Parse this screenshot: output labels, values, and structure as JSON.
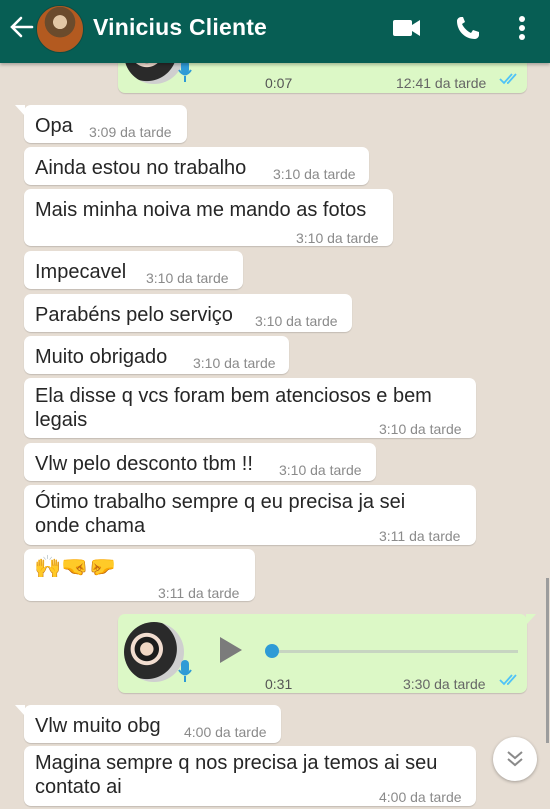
{
  "header": {
    "contact_name": "Vinicius Cliente",
    "icons": [
      "back-arrow-icon",
      "contact-avatar",
      "video-call-icon",
      "phone-call-icon",
      "more-options-icon"
    ],
    "color": "#075e54"
  },
  "voice_messages": [
    {
      "duration": "0:07",
      "time": "12:41 da tarde",
      "status": "read"
    },
    {
      "duration": "0:31",
      "time": "3:30 da tarde",
      "status": "read"
    }
  ],
  "messages": [
    {
      "text": "Opa",
      "time": "3:09 da tarde"
    },
    {
      "text": "Ainda estou no trabalho",
      "time": "3:10 da tarde"
    },
    {
      "text": "Mais minha noiva me mando as fotos",
      "time": "3:10 da tarde"
    },
    {
      "text": "Impecavel",
      "time": "3:10 da tarde"
    },
    {
      "text": "Parabéns pelo serviço",
      "time": "3:10 da tarde"
    },
    {
      "text": "Muito obrigado",
      "time": "3:10 da tarde"
    },
    {
      "line1": "Ela disse q vcs foram bem atenciosos e bem",
      "line2": "legais",
      "time": "3:10 da tarde"
    },
    {
      "text": "Vlw pelo desconto tbm !!",
      "time": "3:10 da tarde"
    },
    {
      "line1": "Ótimo trabalho sempre q eu precisa ja sei",
      "line2": "onde chama",
      "time": "3:11 da tarde"
    },
    {
      "emojis": "🙌🤜🤛",
      "time": "3:11 da tarde"
    },
    {
      "text": "Vlw muito obg",
      "time": "4:00 da tarde"
    },
    {
      "line1": "Magina sempre q nos precisa ja temos ai seu",
      "line2": "contato ai",
      "time": "4:00 da tarde"
    }
  ],
  "colors": {
    "chat_bg": "#e6ddd3",
    "outgoing": "#dcf8c6",
    "incoming": "#ffffff",
    "read_ticks": "#4fc3f7"
  }
}
